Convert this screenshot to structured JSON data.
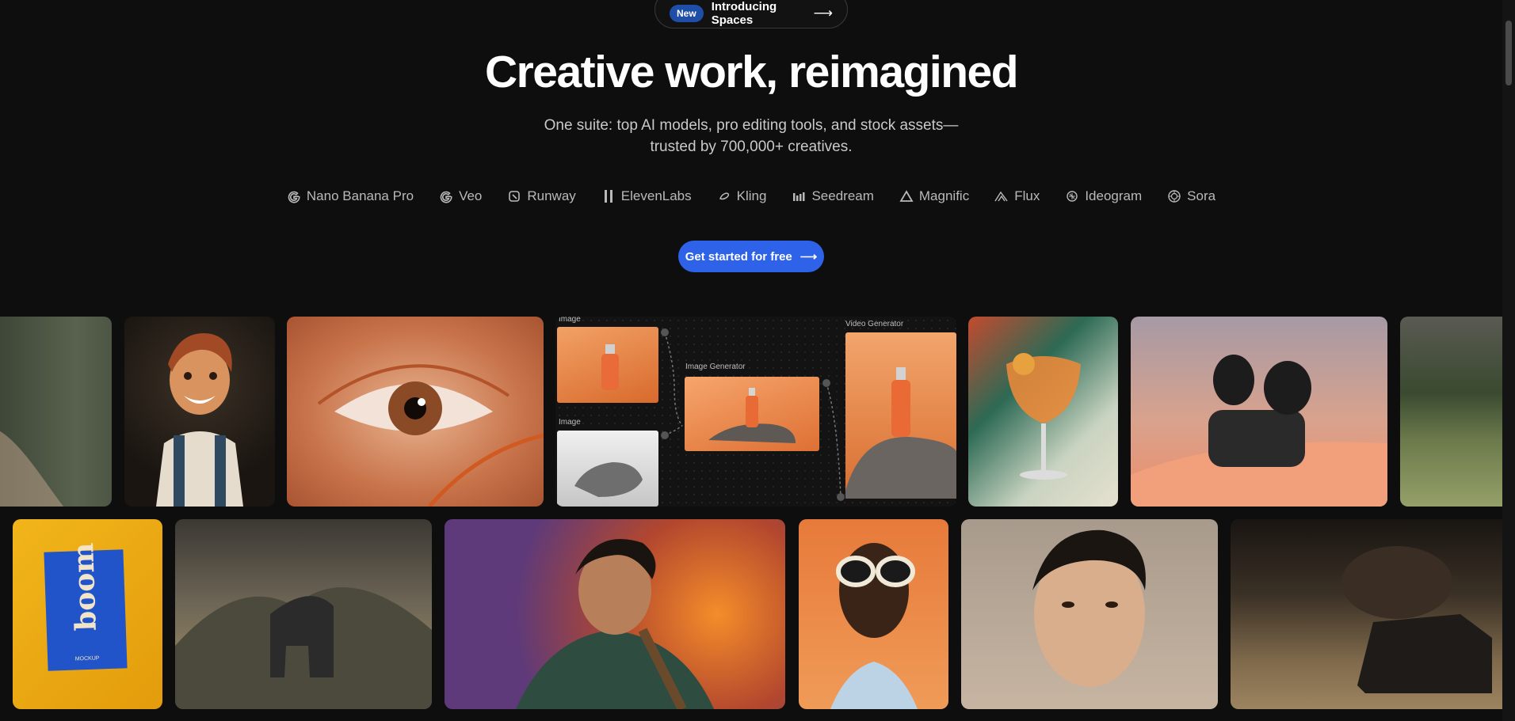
{
  "announcement": {
    "badge": "New",
    "text": "Introducing Spaces",
    "arrow": "⟶"
  },
  "hero": {
    "title": "Creative work, reimagined",
    "subtitle_line1": "One suite: top AI models, pro editing tools, and stock assets—",
    "subtitle_line2": "trusted by 700,000+ creatives."
  },
  "models": [
    {
      "label": "Nano Banana Pro",
      "icon": "google-icon"
    },
    {
      "label": "Veo",
      "icon": "google-icon"
    },
    {
      "label": "Runway",
      "icon": "runway-icon"
    },
    {
      "label": "ElevenLabs",
      "icon": "elevenlabs-icon"
    },
    {
      "label": "Kling",
      "icon": "kling-icon"
    },
    {
      "label": "Seedream",
      "icon": "seedream-icon"
    },
    {
      "label": "Magnific",
      "icon": "magnific-icon"
    },
    {
      "label": "Flux",
      "icon": "flux-icon"
    },
    {
      "label": "Ideogram",
      "icon": "ideogram-icon"
    },
    {
      "label": "Sora",
      "icon": "openai-icon"
    }
  ],
  "cta": {
    "label": "Get started for free",
    "arrow": "⟶"
  },
  "workflow": {
    "image_label_1": "Image",
    "image_label_2": "Image",
    "generator_label": "Image Generator",
    "video_label": "Video Generator"
  },
  "mockup": {
    "text": "boom",
    "sub": "MOCKUP"
  },
  "colors": {
    "background": "#0e0e0e",
    "accent": "#2e62e8",
    "badge": "#1f4ea8"
  }
}
